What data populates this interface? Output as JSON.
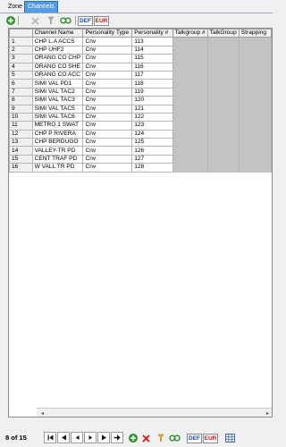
{
  "tabs": [
    {
      "label": "Zone",
      "active": false
    },
    {
      "label": "Channels",
      "active": true
    }
  ],
  "toolbar": {
    "icons": [
      "add-icon",
      "delete-icon",
      "filter-icon",
      "link-icon",
      "def-icon",
      "eur-icon"
    ],
    "def_label": "DEF",
    "eur_label": "EUR"
  },
  "grid": {
    "columns": [
      "Channel Name",
      "Personality Type",
      "Personality #",
      "Talkgroup #",
      "TalkGroup",
      "Strapping"
    ],
    "rows": [
      {
        "n": "1",
        "name": "CHP L.A ACCS",
        "type": "Cnv",
        "num": "113"
      },
      {
        "n": "2",
        "name": "CHP UHF2",
        "type": "Cnv",
        "num": "114"
      },
      {
        "n": "3",
        "name": "ORANG CO CHP",
        "type": "Cnv",
        "num": "115"
      },
      {
        "n": "4",
        "name": "ORANG CO SHE",
        "type": "Cnv",
        "num": "116"
      },
      {
        "n": "5",
        "name": "ORANG CO ACC",
        "type": "Cnv",
        "num": "117"
      },
      {
        "n": "6",
        "name": "SIMI VAL PD1",
        "type": "Cnv",
        "num": "118"
      },
      {
        "n": "7",
        "name": "SIMI VAL TAC2",
        "type": "Cnv",
        "num": "119"
      },
      {
        "n": "8",
        "name": "SIMI VAL TAC3",
        "type": "Cnv",
        "num": "120"
      },
      {
        "n": "9",
        "name": "SIMI VAL TAC5",
        "type": "Cnv",
        "num": "121"
      },
      {
        "n": "10",
        "name": "SIMI VAL TAC6",
        "type": "Cnv",
        "num": "122"
      },
      {
        "n": "11",
        "name": "METRO 1 SWAT",
        "type": "Cnv",
        "num": "123"
      },
      {
        "n": "12",
        "name": "CHP P RIVERA",
        "type": "Cnv",
        "num": "124"
      },
      {
        "n": "13",
        "name": "CHP BERDUGO",
        "type": "Cnv",
        "num": "125"
      },
      {
        "n": "14",
        "name": "VALLEY-TR PD",
        "type": "Cnv",
        "num": "126"
      },
      {
        "n": "15",
        "name": "CENT TRAF PD",
        "type": "Cnv",
        "num": "127"
      },
      {
        "n": "16",
        "name": "W VALL TR PD",
        "type": "Cnv",
        "num": "128"
      }
    ]
  },
  "status": {
    "record": "8 of 15",
    "nav_icons": [
      "first-icon",
      "prev-page-icon",
      "prev-icon",
      "next-icon",
      "next-page-icon",
      "new-record-icon"
    ],
    "def_label": "DEF",
    "eur_label": "EUR"
  },
  "colors": {
    "active_tab": "#4f9de4",
    "disabled_cell": "#c3c3c3",
    "grid_border": "#b5b5b5"
  }
}
